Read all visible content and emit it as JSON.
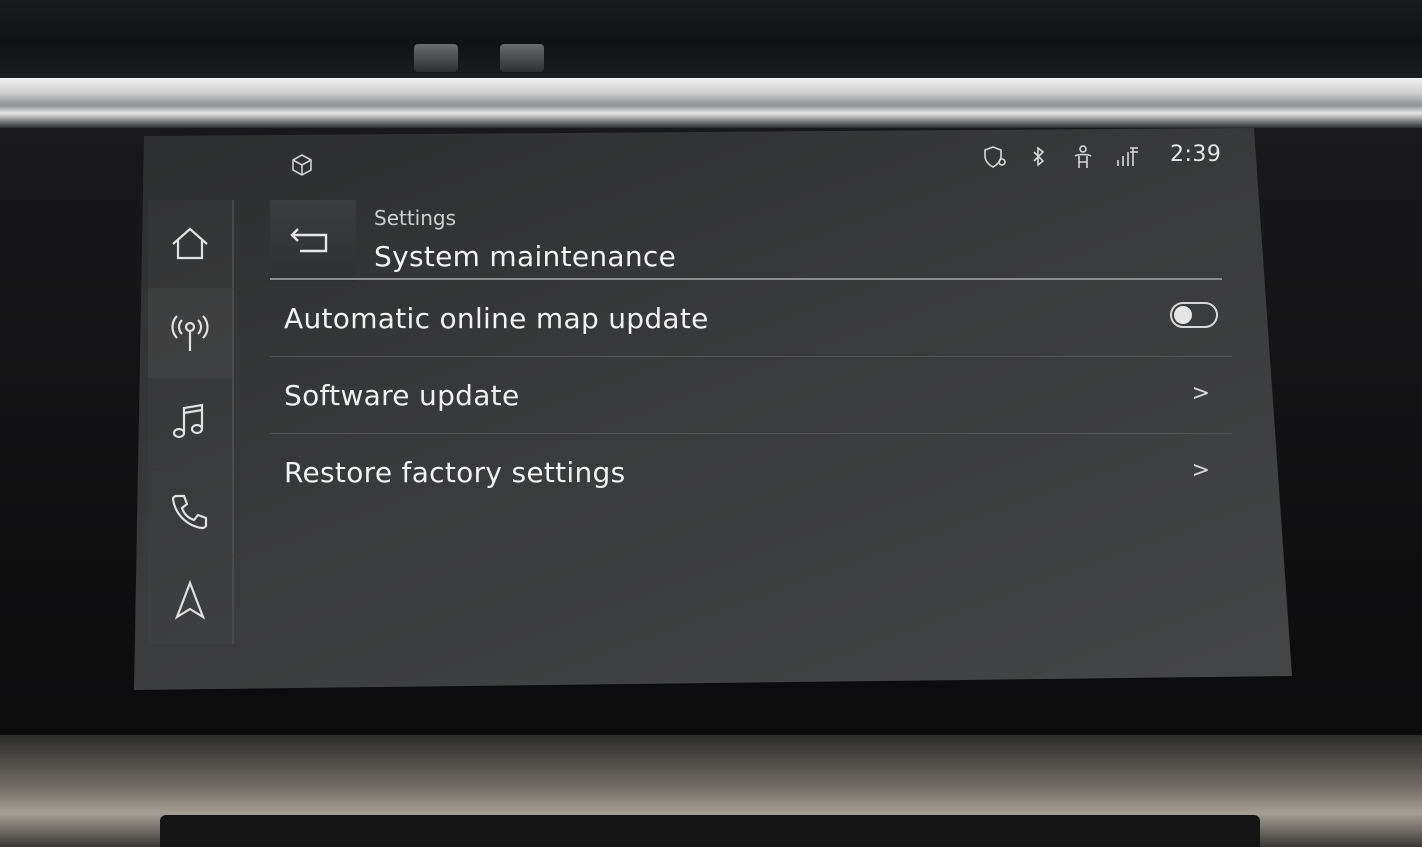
{
  "status_bar": {
    "time": "2:39",
    "icons": [
      "shield-location-icon",
      "bluetooth-icon",
      "seat-person-icon",
      "lte-signal-icon"
    ]
  },
  "rail": {
    "items": [
      {
        "icon": "home-icon"
      },
      {
        "icon": "radio-antenna-icon"
      },
      {
        "icon": "music-note-icon"
      },
      {
        "icon": "phone-icon"
      },
      {
        "icon": "navigation-arrow-icon"
      }
    ]
  },
  "header": {
    "breadcrumb": "Settings",
    "title": "System maintenance"
  },
  "list": {
    "items": [
      {
        "label": "Automatic online map update",
        "control": "toggle",
        "state": "off"
      },
      {
        "label": "Software update",
        "control": "chevron",
        "chevron": ">"
      },
      {
        "label": "Restore factory settings",
        "control": "chevron",
        "chevron": ">"
      }
    ]
  }
}
